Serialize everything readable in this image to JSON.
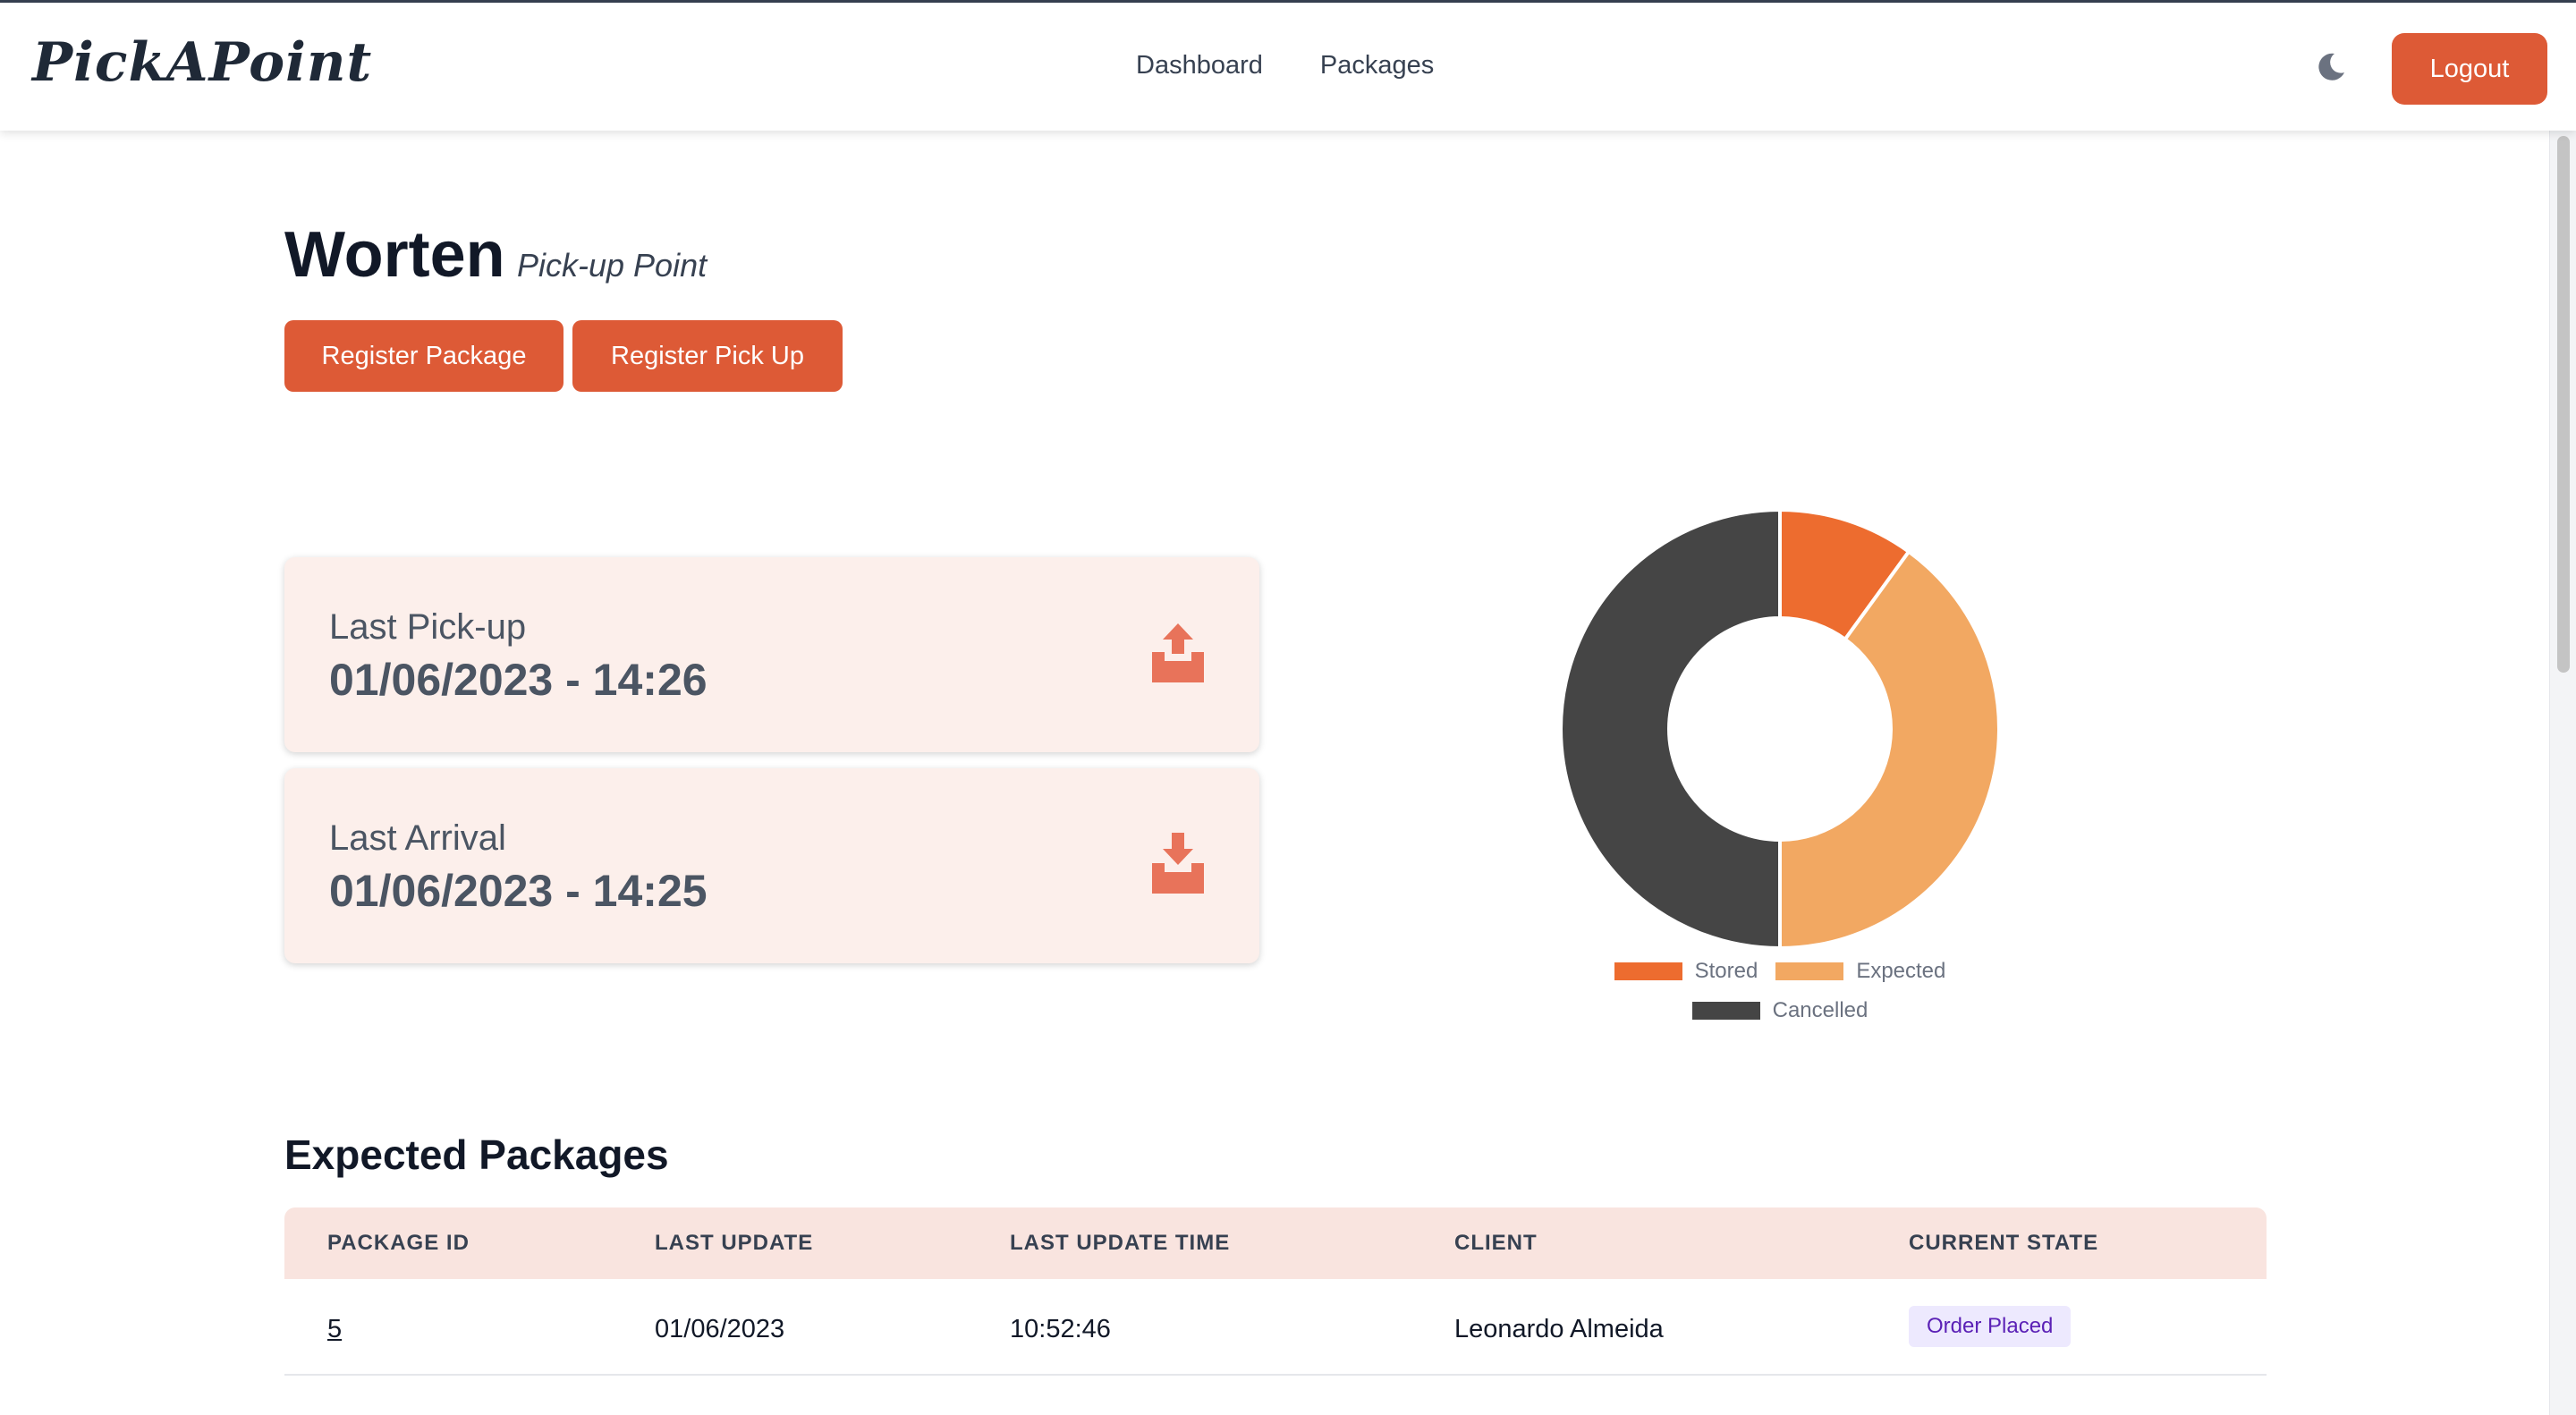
{
  "navbar": {
    "brand": "PickAPoint",
    "links": [
      "Dashboard",
      "Packages"
    ],
    "logout_label": "Logout"
  },
  "header": {
    "store_name": "Worten",
    "store_type": "Pick-up Point",
    "register_package_label": "Register Package",
    "register_pickup_label": "Register Pick Up"
  },
  "cards": [
    {
      "label": "Last Pick-up",
      "value": "01/06/2023 - 14:26",
      "icon": "upload-tray-icon"
    },
    {
      "label": "Last Arrival",
      "value": "01/06/2023 - 14:25",
      "icon": "download-tray-icon"
    }
  ],
  "chart_data": {
    "type": "pie",
    "categories": [
      "Stored",
      "Expected",
      "Cancelled"
    ],
    "values": [
      1,
      4,
      5
    ],
    "colors": [
      "#ed6c2f",
      "#f2a862",
      "#454545"
    ],
    "donut": true,
    "legend": "bottom"
  },
  "table": {
    "title": "Expected Packages",
    "headers": [
      "PACKAGE ID",
      "LAST UPDATE",
      "LAST UPDATE TIME",
      "CLIENT",
      "CURRENT STATE"
    ],
    "rows": [
      {
        "id": "5",
        "date": "01/06/2023",
        "time": "10:52:46",
        "client": "Leonardo Almeida",
        "state": "Order Placed"
      }
    ]
  },
  "colors": {
    "accent": "#dd5a36",
    "card_bg": "#fcefeb",
    "table_head_bg": "#f9e4df"
  }
}
